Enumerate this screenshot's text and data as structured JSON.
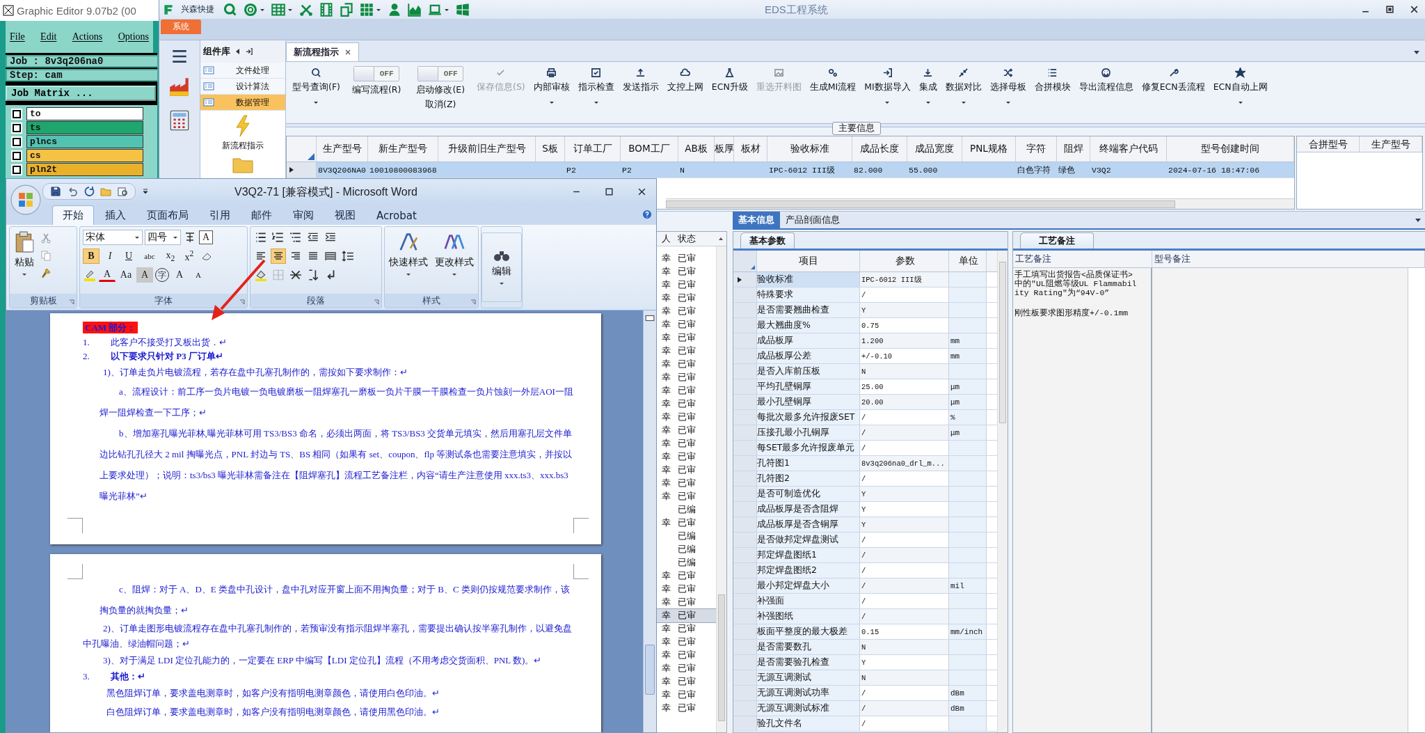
{
  "editor": {
    "title": "Graphic Editor 9.07b2 (00",
    "menu": [
      "File",
      "Edit",
      "Actions",
      "Options"
    ],
    "job": "Job : 8v3q206na0",
    "step": "Step: cam",
    "matrix_button": "Job Matrix ...",
    "layers": [
      {
        "name": "to",
        "color": "#ffffff",
        "checked": false
      },
      {
        "name": "ts",
        "color": "#1fa56e",
        "checked": false
      },
      {
        "name": "plncs",
        "color": "#52c3b0",
        "checked": false
      },
      {
        "name": "cs",
        "color": "#f6c244",
        "checked": false
      },
      {
        "name": "pln2t",
        "color": "#e9b02a",
        "checked": false
      }
    ]
  },
  "eds": {
    "title": "EDS工程系统",
    "quick_label": "兴森快捷",
    "ribbon_tabs": [
      {
        "label": "系统",
        "selected": true
      }
    ],
    "component_panel": {
      "title": "组件库",
      "items": [
        {
          "label": "文件处理",
          "selected": false
        },
        {
          "label": "设计算法",
          "selected": false
        },
        {
          "label": "数据管理",
          "selected": true
        }
      ],
      "tool": "新流程指示"
    },
    "doc_tabs": [
      {
        "label": "新流程指示",
        "selected": true
      }
    ],
    "toolbar": [
      {
        "kind": "button",
        "label": "型号查询(F)",
        "dropdown": true,
        "disabled": false
      },
      {
        "kind": "toggle",
        "label": "编写流程(R)",
        "switch_text": "OFF",
        "on": false
      },
      {
        "kind": "toggle",
        "label": "启动修改(E)",
        "sublabel": "取消(Z)",
        "switch_text": "OFF",
        "on": false
      },
      {
        "kind": "button",
        "label": "保存信息(S)",
        "dropdown": false,
        "disabled": true
      },
      {
        "kind": "button",
        "label": "内部审核",
        "dropdown": true,
        "disabled": false
      },
      {
        "kind": "button",
        "label": "指示检查",
        "dropdown": true,
        "disabled": false
      },
      {
        "kind": "button",
        "label": "发送指示",
        "dropdown": false,
        "disabled": false
      },
      {
        "kind": "button",
        "label": "文控上网",
        "dropdown": false,
        "disabled": false
      },
      {
        "kind": "button",
        "label": "ECN升级",
        "dropdown": false,
        "disabled": false
      },
      {
        "kind": "button",
        "label": "重选开料图",
        "dropdown": false,
        "disabled": true
      },
      {
        "kind": "button",
        "label": "生成MI流程",
        "dropdown": false,
        "disabled": false
      },
      {
        "kind": "button",
        "label": "MI数据导入",
        "dropdown": true,
        "disabled": false
      },
      {
        "kind": "button",
        "label": "集成",
        "dropdown": true,
        "disabled": false
      },
      {
        "kind": "button",
        "label": "数据对比",
        "dropdown": true,
        "disabled": false
      },
      {
        "kind": "button",
        "label": "选择母板",
        "dropdown": true,
        "disabled": false
      },
      {
        "kind": "button",
        "label": "合拼模块",
        "dropdown": false,
        "disabled": false
      },
      {
        "kind": "button",
        "label": "导出流程信息",
        "dropdown": false,
        "disabled": false
      },
      {
        "kind": "button",
        "label": "修复ECN丢流程",
        "dropdown": false,
        "disabled": false
      },
      {
        "kind": "button",
        "label": "ECN自动上网",
        "dropdown": true,
        "disabled": false
      }
    ],
    "main_info": {
      "legend": "主要信息",
      "columns": [
        "生产型号",
        "新生产型号",
        "升级前旧生产型号",
        "S板",
        "订单工厂",
        "BOM工厂",
        "AB板",
        "板厚",
        "板材",
        "验收标准",
        "成品长度",
        "成品宽度",
        "PNL规格",
        "字符",
        "阻焊",
        "终端客户代码",
        "型号创建时间"
      ],
      "rows": [
        {
          "selected": true,
          "cells": [
            "8V3Q206NA0",
            "10010800083968",
            null,
            null,
            "P2",
            "P2",
            "N",
            null,
            null,
            "IPC-6012 III级",
            "82.000",
            "55.000",
            null,
            "白色字符",
            "绿色",
            "V3Q2",
            "2024-07-16 18:47:06"
          ]
        }
      ],
      "side_columns": [
        "合拼型号",
        "生产型号"
      ]
    },
    "review_list": {
      "columns": [
        "人",
        "状态"
      ],
      "rows": [
        {
          "name": "幸",
          "status": "已审",
          "selected": false
        },
        {
          "name": "幸",
          "status": "已审",
          "selected": false
        },
        {
          "name": "幸",
          "status": "已审",
          "selected": false
        },
        {
          "name": "幸",
          "status": "已审",
          "selected": false
        },
        {
          "name": "幸",
          "status": "已审",
          "selected": false
        },
        {
          "name": "幸",
          "status": "已审",
          "selected": false
        },
        {
          "name": "幸",
          "status": "已审",
          "selected": false
        },
        {
          "name": "幸",
          "status": "已审",
          "selected": false
        },
        {
          "name": "幸",
          "status": "已审",
          "selected": false
        },
        {
          "name": "幸",
          "status": "已审",
          "selected": false
        },
        {
          "name": "幸",
          "status": "已审",
          "selected": false
        },
        {
          "name": "幸",
          "status": "已审",
          "selected": false
        },
        {
          "name": "幸",
          "status": "已审",
          "selected": false
        },
        {
          "name": "幸",
          "status": "已审",
          "selected": false
        },
        {
          "name": "幸",
          "status": "已审",
          "selected": false
        },
        {
          "name": "幸",
          "status": "已审",
          "selected": false
        },
        {
          "name": "幸",
          "status": "已审",
          "selected": false
        },
        {
          "name": "幸",
          "status": "已审",
          "selected": false
        },
        {
          "name": "幸",
          "status": "已审",
          "selected": false
        },
        {
          "status": "已编",
          "selected": false
        },
        {
          "name": "幸",
          "status": "已审",
          "selected": false
        },
        {
          "status": "已编",
          "selected": false
        },
        {
          "status": "已编",
          "selected": false
        },
        {
          "status": "已编",
          "selected": false
        },
        {
          "name": "幸",
          "status": "已审",
          "selected": false
        },
        {
          "name": "幸",
          "status": "已审",
          "selected": false
        },
        {
          "name": "幸",
          "status": "已审",
          "selected": false
        },
        {
          "name": "幸",
          "status": "已审",
          "selected": true
        },
        {
          "name": "幸",
          "status": "已审",
          "selected": false
        },
        {
          "name": "幸",
          "status": "已审",
          "selected": false
        },
        {
          "name": "幸",
          "status": "已审",
          "selected": false
        },
        {
          "name": "幸",
          "status": "已审",
          "selected": false
        },
        {
          "name": "幸",
          "status": "已审",
          "selected": false
        },
        {
          "name": "幸",
          "status": "已审",
          "selected": false
        },
        {
          "name": "幸",
          "status": "已审",
          "selected": false
        }
      ]
    },
    "detail": {
      "tabs": [
        {
          "label": "基本信息",
          "selected": true
        },
        {
          "label": "产品剖面信息",
          "selected": false
        }
      ],
      "params": {
        "tab": "基本参数",
        "columns": [
          "项目",
          "参数",
          "单位"
        ],
        "rows": [
          {
            "item": "验收标准",
            "value": "IPC-6012 III级",
            "selected": true
          },
          {
            "item": "特殊要求",
            "value": "/",
            "selected": false
          },
          {
            "item": "是否需要翘曲检查",
            "value": "Y",
            "selected": false
          },
          {
            "item": "最大翘曲度%",
            "value": "0.75",
            "selected": false
          },
          {
            "item": "成品板厚",
            "value": "1.200",
            "unit": "mm",
            "selected": false
          },
          {
            "item": "成品板厚公差",
            "value": "+/-0.10",
            "unit": "mm",
            "selected": false
          },
          {
            "item": "是否入库前压板",
            "value": "N",
            "selected": false
          },
          {
            "item": "平均孔壁铜厚",
            "value": "25.00",
            "unit": "μm",
            "selected": false
          },
          {
            "item": "最小孔壁铜厚",
            "value": "20.00",
            "unit": "μm",
            "selected": false
          },
          {
            "item": "每批次最多允许报废SET",
            "value": "/",
            "unit": "%",
            "selected": false
          },
          {
            "item": "压接孔最小孔铜厚",
            "value": "/",
            "unit": "μm",
            "selected": false
          },
          {
            "item": "每SET最多允许报废单元",
            "value": "/",
            "selected": false
          },
          {
            "item": "孔符图1",
            "value": "8v3q206na0_drl_m...",
            "selected": false
          },
          {
            "item": "孔符图2",
            "value": "/",
            "selected": false
          },
          {
            "item": "是否可制造优化",
            "value": "Y",
            "selected": false
          },
          {
            "item": "成品板厚是否含阻焊",
            "value": "Y",
            "selected": false
          },
          {
            "item": "成品板厚是否含铜厚",
            "value": "Y",
            "selected": false
          },
          {
            "item": "是否做邦定焊盘测试",
            "value": "/",
            "selected": false
          },
          {
            "item": "邦定焊盘图纸1",
            "value": "/",
            "selected": false
          },
          {
            "item": "邦定焊盘图纸2",
            "value": "/",
            "selected": false
          },
          {
            "item": "最小邦定焊盘大小",
            "value": "/",
            "unit": "mil",
            "selected": false
          },
          {
            "item": "补强面",
            "value": "/",
            "selected": false
          },
          {
            "item": "补强图纸",
            "value": "/",
            "selected": false
          },
          {
            "item": "板面平整度的最大极差",
            "value": "0.15",
            "unit": "mm/inch",
            "selected": false
          },
          {
            "item": "是否需要数孔",
            "value": "N",
            "selected": false
          },
          {
            "item": "是否需要验孔检查",
            "value": "Y",
            "selected": false
          },
          {
            "item": "无源互调测试",
            "value": "N",
            "selected": false
          },
          {
            "item": "无源互调测试功率",
            "value": "/",
            "unit": "dBm",
            "selected": false
          },
          {
            "item": "无源互调测试标准",
            "value": "/",
            "unit": "dBm",
            "selected": false
          },
          {
            "item": "验孔文件名",
            "value": "/",
            "selected": false
          }
        ]
      },
      "notes": {
        "tab": "工艺备注",
        "columns": [
          "工艺备注",
          "型号备注"
        ],
        "lines": [
          "手工填写出货报告<品质保证书>中的\"UL阻燃等级UL Flammability Rating\"为“94V-0”",
          "刚性板要求图形精度+/-0.1mm"
        ]
      }
    }
  },
  "word": {
    "title": "V3Q2-71 [兼容模式] - Microsoft Word",
    "tabs": [
      {
        "label": "开始",
        "selected": true
      },
      {
        "label": "插入",
        "selected": false
      },
      {
        "label": "页面布局",
        "selected": false
      },
      {
        "label": "引用",
        "selected": false
      },
      {
        "label": "邮件",
        "selected": false
      },
      {
        "label": "审阅",
        "selected": false
      },
      {
        "label": "视图",
        "selected": false
      },
      {
        "label": "Acrobat",
        "selected": false
      }
    ],
    "clipboard": {
      "label": "剪贴板",
      "paste": "粘贴"
    },
    "font": {
      "label": "字体",
      "name": "宋体",
      "size": "四号",
      "border_char": "A",
      "format_buttons": [
        {
          "text": "B",
          "active": true
        },
        {
          "text": "I",
          "active": false
        },
        {
          "text": "U",
          "active": false
        },
        {
          "text": "abc",
          "active": false
        },
        {
          "text": "x$_{2}$",
          "active": false
        },
        {
          "text": "x$^{2}$",
          "active": false
        }
      ],
      "color_char": "A",
      "case_text": "Aa",
      "shading_char": "A",
      "enclose_char": "字",
      "grow_char": "A",
      "shrink_char": "A"
    },
    "paragraph": {
      "label": "段落",
      "align": [
        {
          "kind": "left",
          "selected": false
        },
        {
          "kind": "center",
          "selected": true
        },
        {
          "kind": "right",
          "selected": false
        },
        {
          "kind": "justify",
          "selected": false
        },
        {
          "kind": "distributed",
          "selected": false
        }
      ]
    },
    "styles": {
      "label": "样式",
      "quick": "快速样式",
      "change": "更改样式"
    },
    "editing": {
      "label": "编辑"
    },
    "pages": [
      {
        "paragraphs": [
          {
            "kind": "title",
            "text": "CAM 部分：",
            "highlighted": true
          },
          {
            "kind": "numbered",
            "number": "1.",
            "text": "此客户不接受打叉板出货．↵",
            "bold": false
          },
          {
            "kind": "numbered",
            "number": "2.",
            "text": "以下要求只针对 P3 厂订单↵",
            "bold": true
          },
          {
            "kind": "sub",
            "text": "1)、订单走负片电镀流程，若存在盘中孔塞孔制作的，需按如下要求制作：↵"
          },
          {
            "kind": "detail",
            "text": "a、流程设计：前工序一负片电镀一负电镀磨板一阻焊塞孔一磨板一负片干膜一干膜检查一负片蚀刻一外层AOI一阻焊一阻焊检查一下工序；↵"
          },
          {
            "kind": "detail",
            "text": "b、增加塞孔曝光菲林,曝光菲林可用 TS3/BS3 命名，必须出两面，将 TS3/BS3 交货单元填实，然后用塞孔层文件单边比钻孔孔径大 2 mil 掏曝光点，PNL 封边与 TS、BS 相同（如果有 set、coupon、flp 等测试条也需要注意填实，并按以上要求处理）；说明：ts3/bs3 曝光菲林需备注在【阻焊塞孔】流程工艺备注栏，内容“请生产注意使用 xxx.ts3、xxx.bs3 曝光菲林”↵"
          }
        ]
      },
      {
        "paragraphs": [
          {
            "kind": "detail",
            "text": "c、阻焊：对于 A、D、E 类盘中孔设计，盘中孔对应开窗上面不用掏负量；对于 B、C 类则仍按规范要求制作，该掏负量的就掏负量；↵"
          },
          {
            "kind": "hanging",
            "text": "2)、订单走图形电镀流程存在盘中孔塞孔制作的，若预审没有指示阻焊半塞孔，需要提出确认按半塞孔制作，以避免盘中孔曝油、绿油帽问题；↵"
          },
          {
            "kind": "sub",
            "text": "3)、对于满足 LDI 定位孔能力的，一定要在 ERP 中编写【LDI 定位孔】流程（不用考虑交货面积、PNL 数)。↵"
          },
          {
            "kind": "numbered",
            "number": "3.",
            "text": "其他：↵",
            "bold": true
          },
          {
            "kind": "body",
            "text": "黑色阻焊订单，要求盖电测章时，如客户没有指明电测章颜色，请使用白色印油。↵"
          },
          {
            "kind": "body",
            "text": "白色阻焊订单，要求盖电测章时，如客户没有指明电测章颜色，请使用黑色印油。↵"
          }
        ]
      }
    ]
  }
}
